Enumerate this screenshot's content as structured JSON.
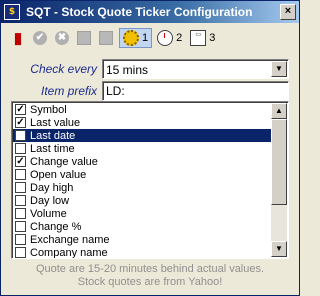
{
  "window": {
    "title": "SQT - Stock Quote Ticker Configuration",
    "app_icon_text": "$",
    "close_glyph": "×"
  },
  "toolbar": {
    "tabs": [
      {
        "label": "1",
        "icon": "gear-icon",
        "active": true
      },
      {
        "label": "2",
        "icon": "clock-icon",
        "active": false
      },
      {
        "label": "3",
        "icon": "window-icon",
        "active": false
      }
    ],
    "check_glyph": "✔",
    "cancel_glyph": "✖"
  },
  "form": {
    "check_every_label": "Check every",
    "check_every_value": "15 mins",
    "item_prefix_label": "Item prefix",
    "item_prefix_value": "LD:"
  },
  "list": {
    "items": [
      {
        "label": "Symbol",
        "checked": true,
        "selected": false
      },
      {
        "label": "Last value",
        "checked": true,
        "selected": false
      },
      {
        "label": "Last date",
        "checked": false,
        "selected": true
      },
      {
        "label": "Last time",
        "checked": false,
        "selected": false
      },
      {
        "label": "Change value",
        "checked": true,
        "selected": false
      },
      {
        "label": "Open value",
        "checked": false,
        "selected": false
      },
      {
        "label": "Day high",
        "checked": false,
        "selected": false
      },
      {
        "label": "Day low",
        "checked": false,
        "selected": false
      },
      {
        "label": "Volume",
        "checked": false,
        "selected": false
      },
      {
        "label": "Change %",
        "checked": false,
        "selected": false
      },
      {
        "label": "Exchange name",
        "checked": false,
        "selected": false
      },
      {
        "label": "Company name",
        "checked": false,
        "selected": false
      }
    ]
  },
  "footer": {
    "line1": "Quote are 15-20 minutes behind actual values.",
    "line2": "Stock quotes are from Yahoo!"
  }
}
